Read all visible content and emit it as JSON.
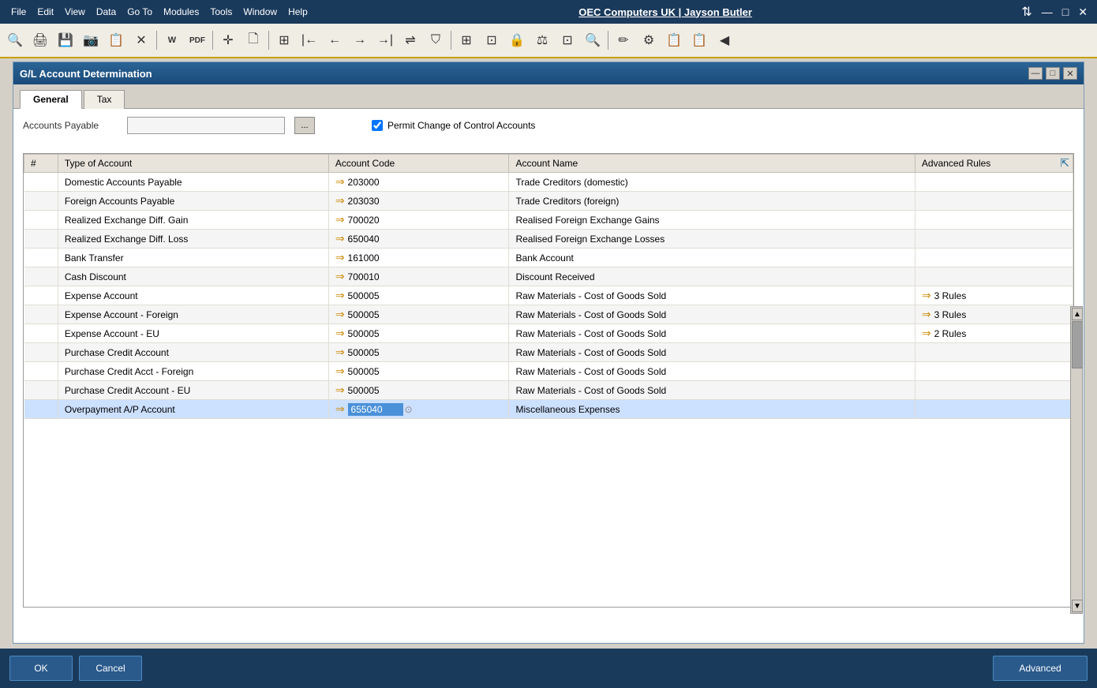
{
  "titlebar": {
    "menu_items": [
      "File",
      "Edit",
      "View",
      "Data",
      "Go To",
      "Modules",
      "Tools",
      "Window",
      "Help"
    ],
    "company": "OEC Computers UK | Jayson Butler",
    "controls": [
      "⇅",
      "—",
      "□",
      "✕"
    ]
  },
  "dialog": {
    "title": "G/L Account Determination",
    "controls": [
      "—",
      "□",
      "✕"
    ],
    "tabs": [
      {
        "label": "General",
        "active": true
      },
      {
        "label": "Tax",
        "active": false
      }
    ],
    "accounts_label": "Accounts Payable",
    "accounts_browse_label": "...",
    "permit_change_label": "Permit Change of Control Accounts",
    "table": {
      "columns": [
        {
          "key": "num",
          "label": "#"
        },
        {
          "key": "type",
          "label": "Type of Account"
        },
        {
          "key": "code",
          "label": "Account Code"
        },
        {
          "key": "name",
          "label": "Account Name"
        },
        {
          "key": "rules",
          "label": "Advanced Rules"
        }
      ],
      "rows": [
        {
          "type": "Domestic Accounts Payable",
          "code": "203000",
          "name": "Trade Creditors (domestic)",
          "rules": "",
          "highlighted": false
        },
        {
          "type": "Foreign Accounts Payable",
          "code": "203030",
          "name": "Trade Creditors (foreign)",
          "rules": "",
          "highlighted": false
        },
        {
          "type": "Realized Exchange Diff. Gain",
          "code": "700020",
          "name": "Realised Foreign Exchange Gains",
          "rules": "",
          "highlighted": false
        },
        {
          "type": "Realized Exchange Diff. Loss",
          "code": "650040",
          "name": "Realised Foreign Exchange Losses",
          "rules": "",
          "highlighted": false
        },
        {
          "type": "Bank Transfer",
          "code": "161000",
          "name": "Bank Account",
          "rules": "",
          "highlighted": false
        },
        {
          "type": "Cash Discount",
          "code": "700010",
          "name": "Discount Received",
          "rules": "",
          "highlighted": false
        },
        {
          "type": "Expense Account",
          "code": "500005",
          "name": "Raw Materials - Cost of Goods Sold",
          "rules": "3 Rules",
          "highlighted": false
        },
        {
          "type": "Expense Account - Foreign",
          "code": "500005",
          "name": "Raw Materials - Cost of Goods Sold",
          "rules": "3 Rules",
          "highlighted": false
        },
        {
          "type": "Expense Account - EU",
          "code": "500005",
          "name": "Raw Materials - Cost of Goods Sold",
          "rules": "2 Rules",
          "highlighted": false
        },
        {
          "type": "Purchase Credit Account",
          "code": "500005",
          "name": "Raw Materials - Cost of Goods Sold",
          "rules": "",
          "highlighted": false
        },
        {
          "type": "Purchase Credit Acct - Foreign",
          "code": "500005",
          "name": "Raw Materials - Cost of Goods Sold",
          "rules": "",
          "highlighted": false
        },
        {
          "type": "Purchase Credit Account - EU",
          "code": "500005",
          "name": "Raw Materials - Cost of Goods Sold",
          "rules": "",
          "highlighted": false
        },
        {
          "type": "Overpayment A/P Account",
          "code": "655040",
          "name": "Miscellaneous Expenses",
          "rules": "",
          "highlighted": true
        }
      ]
    }
  },
  "buttons": {
    "ok": "OK",
    "cancel": "Cancel",
    "advanced": "Advanced"
  },
  "toolbar": {
    "icons": [
      "🔍",
      "🖨",
      "💾",
      "📷",
      "📋",
      "✕",
      "W",
      "PDF",
      "✛",
      "🗋",
      "⊞",
      "➡",
      "⟵",
      "←",
      "→",
      "→|",
      "⇌",
      "⛉",
      "⊞",
      "⊡",
      "⊡",
      "🔒",
      "⚖",
      "⊡",
      "🔍",
      "✏",
      "⚙",
      "📋",
      "📋",
      "◀"
    ]
  }
}
